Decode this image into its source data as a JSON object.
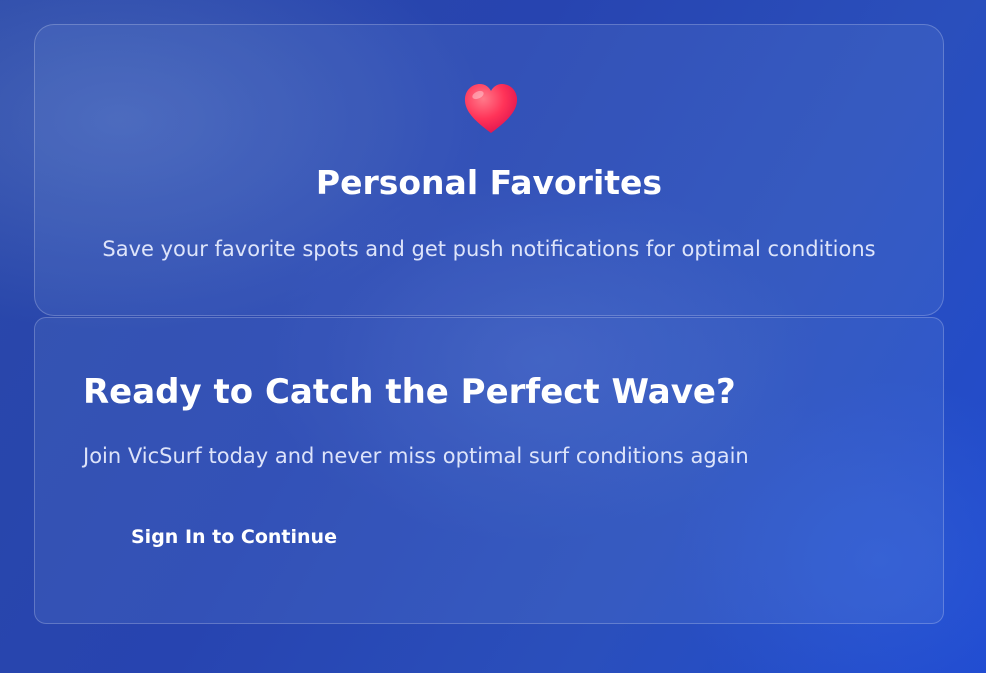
{
  "favorites": {
    "icon": "heart-icon",
    "title": "Personal Favorites",
    "description": "Save your favorite spots and get push notifications for optimal conditions"
  },
  "cta": {
    "title": "Ready to Catch the Perfect Wave?",
    "description": "Join VicSurf today and never miss optimal surf conditions again",
    "button_label": "Sign In to Continue"
  },
  "colors": {
    "background": "#2744b0",
    "heart": "#ff2d62",
    "text": "#ffffff"
  }
}
